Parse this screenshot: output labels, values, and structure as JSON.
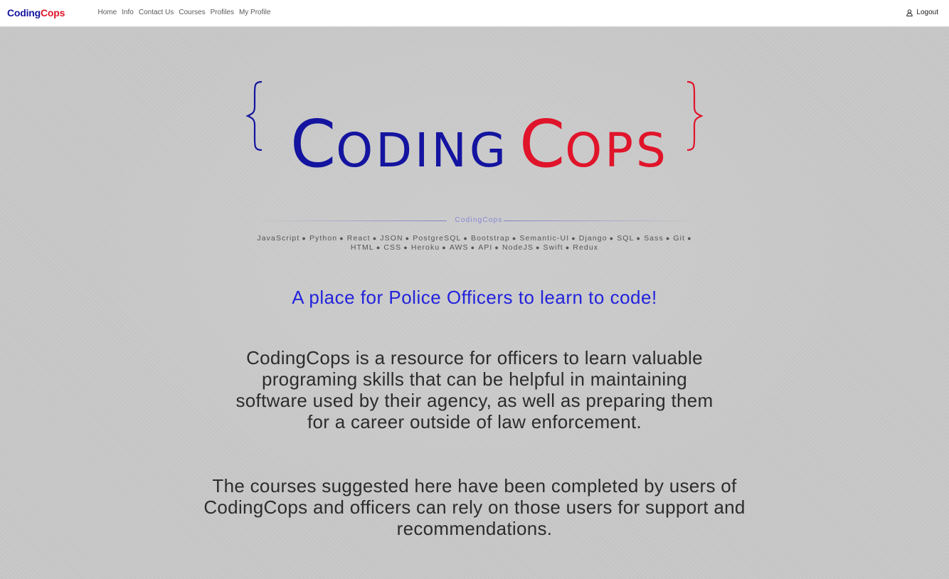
{
  "nav": {
    "brand_part1": "Coding",
    "brand_part2": "Cops",
    "links": [
      "Home",
      "Info",
      "Contact Us",
      "Courses",
      "Profiles",
      "My Profile"
    ],
    "logout_label": "Logout",
    "logout_icon": "user-icon"
  },
  "hero": {
    "logo_part1": "Coding",
    "logo_part2": "Cops",
    "divider_label": "CodingCops",
    "tech_line1": [
      "JavaScript",
      "Python",
      "React",
      "JSON",
      "PostgreSQL",
      "Bootstrap",
      "Semantic-UI",
      "Django",
      "SQL",
      "Sass",
      "Git"
    ],
    "tech_line2": [
      "HTML",
      "CSS",
      "Heroku",
      "AWS",
      "API",
      "NodeJS",
      "Swift",
      "Redux"
    ],
    "tagline": "A place for Police Officers to learn to code!",
    "paragraph1": [
      "CodingCops is a resource for officers to learn valuable",
      "programing skills that can be helpful in maintaining",
      "software used by their agency, as well as preparing them",
      "for a career outside of law enforcement."
    ],
    "paragraph2": [
      "The courses suggested here have been completed by users of",
      "CodingCops and officers can rely on those users for support and",
      "recommendations."
    ]
  },
  "colors": {
    "brand_blue": "#1414a0",
    "brand_red": "#e0142a",
    "tagline_blue": "#2222dd",
    "divider": "#8686d6",
    "background": "#c8c8c8"
  }
}
